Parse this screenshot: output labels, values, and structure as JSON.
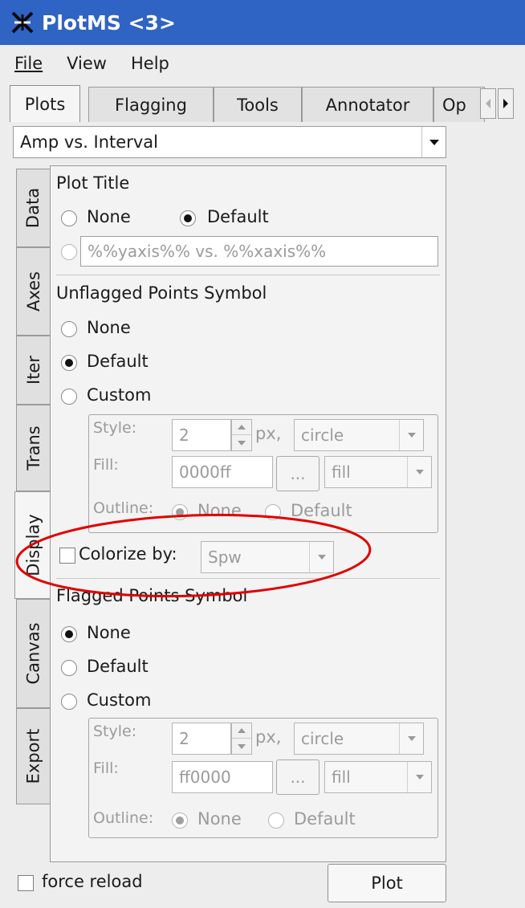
{
  "window": {
    "title": "PlotMS <3>"
  },
  "menu": [
    "File",
    "View",
    "Help"
  ],
  "tabs": [
    "Plots",
    "Flagging",
    "Tools",
    "Annotator",
    "Op"
  ],
  "plot_selector": {
    "value": "Amp vs. Interval"
  },
  "side_tabs": [
    "Data",
    "Axes",
    "Iter",
    "Trans",
    "Display",
    "Canvas",
    "Export"
  ],
  "plot_title": {
    "heading": "Plot Title",
    "option_none": "None",
    "option_default": "Default",
    "selected": "Default",
    "custom_value": "%%yaxis%% vs. %%xaxis%%"
  },
  "unflagged": {
    "heading": "Unflagged Points Symbol",
    "option_none": "None",
    "option_default": "Default",
    "option_custom": "Custom",
    "selected": "Default",
    "style_label": "Style:",
    "size_value": "2",
    "px_label": "px,",
    "shape": "circle",
    "fill_label": "Fill:",
    "fill_color": "0000ff",
    "color_button": "...",
    "fill_type": "fill",
    "outline_label": "Outline:",
    "outline_none": "None",
    "outline_default": "Default"
  },
  "colorize": {
    "label": "Colorize by:",
    "value": "Spw",
    "checked": false
  },
  "flagged": {
    "heading": "Flagged Points Symbol",
    "option_none": "None",
    "option_default": "Default",
    "option_custom": "Custom",
    "selected": "None",
    "style_label": "Style:",
    "size_value": "2",
    "px_label": "px,",
    "shape": "circle",
    "fill_label": "Fill:",
    "fill_color": "ff0000",
    "color_button": "...",
    "fill_type": "fill",
    "outline_label": "Outline:",
    "outline_none": "None",
    "outline_default": "Default"
  },
  "footer": {
    "force_reload_label": "force reload",
    "force_reload_checked": false,
    "plot_button": "Plot"
  },
  "colors": {
    "titlebar": "#2f63c4",
    "annotation_circle": "#e00000"
  }
}
